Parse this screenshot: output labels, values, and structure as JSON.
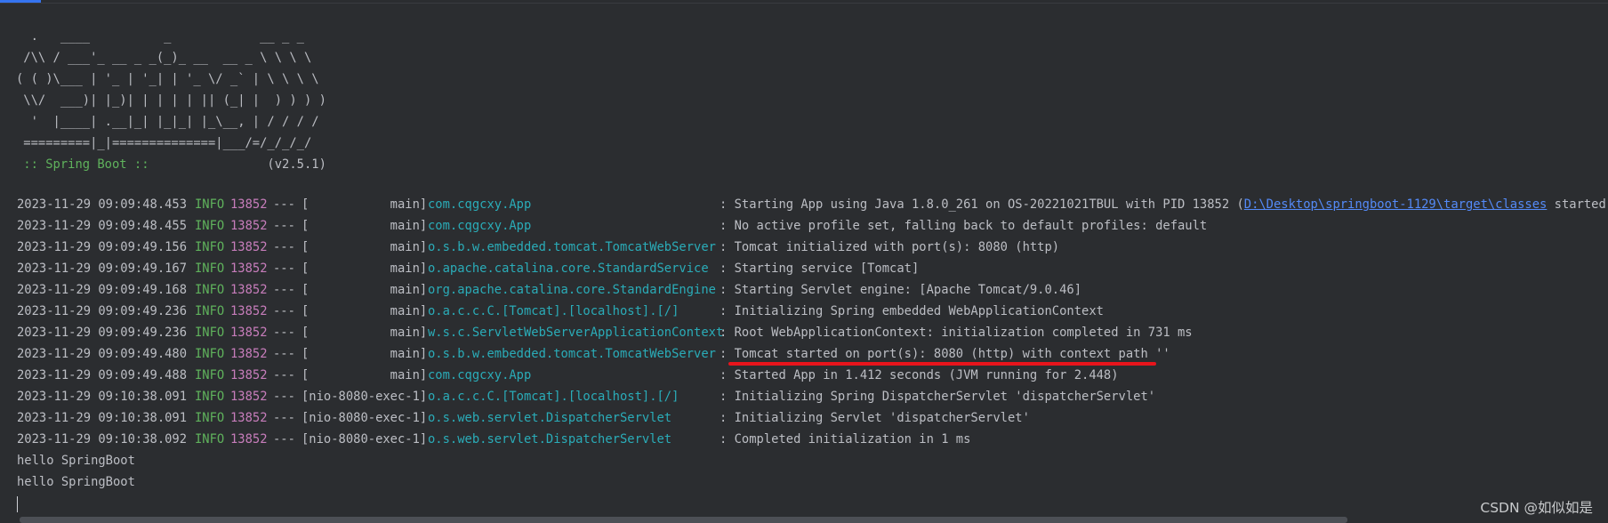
{
  "banner": {
    "art": "  .   ____          _            __ _ _\n /\\\\ / ___'_ __ _ _(_)_ __  __ _ \\ \\ \\ \\\n( ( )\\___ | '_ | '_| | '_ \\/ _` | \\ \\ \\ \\\n \\\\/  ___)| |_)| | | | | || (_| |  ) ) ) )\n  '  |____| .__|_| |_|_| |_\\__, | / / / /\n =========|_|==============|___/=/_/_/_/",
    "spring_boot_label": " :: Spring Boot :: ",
    "version": "               (v2.5.1)"
  },
  "log": {
    "rows": [
      {
        "ts": "2023-11-29 09:09:48.453",
        "level": "INFO",
        "pid": "13852",
        "sep": "---",
        "thread": "[           main]",
        "logger": "com.cqgcxy.App",
        "message": ": Starting App using Java 1.8.0_261 on OS-20221021TBUL with PID 13852 (",
        "link": "D:\\Desktop\\springboot-1129\\target\\classes",
        "tail": " started by A"
      },
      {
        "ts": "2023-11-29 09:09:48.455",
        "level": "INFO",
        "pid": "13852",
        "sep": "---",
        "thread": "[           main]",
        "logger": "com.cqgcxy.App",
        "message": ": No active profile set, falling back to default profiles: default"
      },
      {
        "ts": "2023-11-29 09:09:49.156",
        "level": "INFO",
        "pid": "13852",
        "sep": "---",
        "thread": "[           main]",
        "logger": "o.s.b.w.embedded.tomcat.TomcatWebServer",
        "message": ": Tomcat initialized with port(s): 8080 (http)"
      },
      {
        "ts": "2023-11-29 09:09:49.167",
        "level": "INFO",
        "pid": "13852",
        "sep": "---",
        "thread": "[           main]",
        "logger": "o.apache.catalina.core.StandardService",
        "message": ": Starting service [Tomcat]"
      },
      {
        "ts": "2023-11-29 09:09:49.168",
        "level": "INFO",
        "pid": "13852",
        "sep": "---",
        "thread": "[           main]",
        "logger": "org.apache.catalina.core.StandardEngine",
        "message": ": Starting Servlet engine: [Apache Tomcat/9.0.46]"
      },
      {
        "ts": "2023-11-29 09:09:49.236",
        "level": "INFO",
        "pid": "13852",
        "sep": "---",
        "thread": "[           main]",
        "logger": "o.a.c.c.C.[Tomcat].[localhost].[/]",
        "message": ": Initializing Spring embedded WebApplicationContext"
      },
      {
        "ts": "2023-11-29 09:09:49.236",
        "level": "INFO",
        "pid": "13852",
        "sep": "---",
        "thread": "[           main]",
        "logger": "w.s.c.ServletWebServerApplicationContext",
        "message": ": Root WebApplicationContext: initialization completed in 731 ms"
      },
      {
        "ts": "2023-11-29 09:09:49.480",
        "level": "INFO",
        "pid": "13852",
        "sep": "---",
        "thread": "[           main]",
        "logger": "o.s.b.w.embedded.tomcat.TomcatWebServer",
        "message": ": Tomcat started on port(s): 8080 (http) with context path ''"
      },
      {
        "ts": "2023-11-29 09:09:49.488",
        "level": "INFO",
        "pid": "13852",
        "sep": "---",
        "thread": "[           main]",
        "logger": "com.cqgcxy.App",
        "message": ": Started App in 1.412 seconds (JVM running for 2.448)"
      },
      {
        "ts": "2023-11-29 09:10:38.091",
        "level": "INFO",
        "pid": "13852",
        "sep": "---",
        "thread": "[nio-8080-exec-1]",
        "logger": "o.a.c.c.C.[Tomcat].[localhost].[/]",
        "message": ": Initializing Spring DispatcherServlet 'dispatcherServlet'"
      },
      {
        "ts": "2023-11-29 09:10:38.091",
        "level": "INFO",
        "pid": "13852",
        "sep": "---",
        "thread": "[nio-8080-exec-1]",
        "logger": "o.s.web.servlet.DispatcherServlet",
        "message": ": Initializing Servlet 'dispatcherServlet'"
      },
      {
        "ts": "2023-11-29 09:10:38.092",
        "level": "INFO",
        "pid": "13852",
        "sep": "---",
        "thread": "[nio-8080-exec-1]",
        "logger": "o.s.web.servlet.DispatcherServlet",
        "message": ": Completed initialization in 1 ms"
      }
    ],
    "output": [
      "hello SpringBoot",
      "hello SpringBoot"
    ]
  },
  "watermark": "CSDN @如似如是",
  "colors": {
    "background": "#2b2d30",
    "text": "#bcbec4",
    "info_level": "#5fb25c",
    "pid": "#c77dbb",
    "logger": "#2aacb8",
    "link": "#548af7",
    "annotation_underline": "#e8141c"
  }
}
